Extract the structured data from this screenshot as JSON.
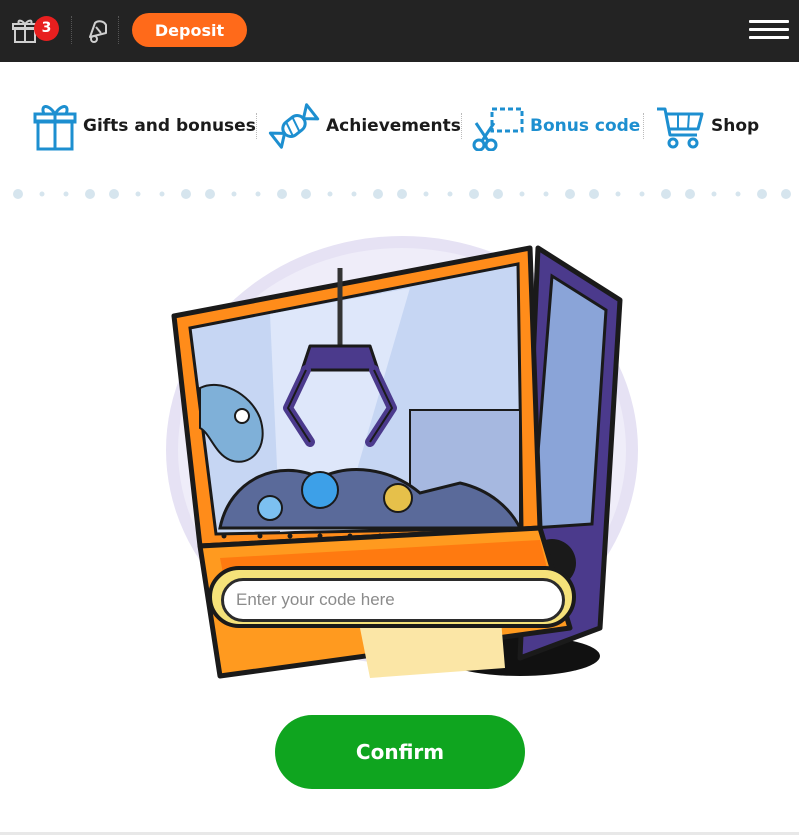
{
  "header": {
    "gift_badge_count": "3",
    "deposit_label": "Deposit",
    "icons": [
      "gift-icon",
      "bell-icon",
      "menu-icon"
    ]
  },
  "nav": {
    "items": [
      {
        "label": "Gifts and bonuses",
        "icon": "gift-icon",
        "active": false
      },
      {
        "label": "Achievements",
        "icon": "candy-icon",
        "active": false
      },
      {
        "label": "Bonus code",
        "icon": "scissors-coupon-icon",
        "active": true
      },
      {
        "label": "Shop",
        "icon": "cart-icon",
        "active": false
      }
    ],
    "active_color": "#1d8fd0"
  },
  "bonus_form": {
    "placeholder": "Enter your code here",
    "value": "",
    "confirm_label": "Confirm",
    "illustration": "claw-machine-illustration"
  },
  "colors": {
    "topbar": "#232323",
    "deposit": "#ff6a1a",
    "confirm": "#0fa51f",
    "badge": "#e81f1f"
  }
}
